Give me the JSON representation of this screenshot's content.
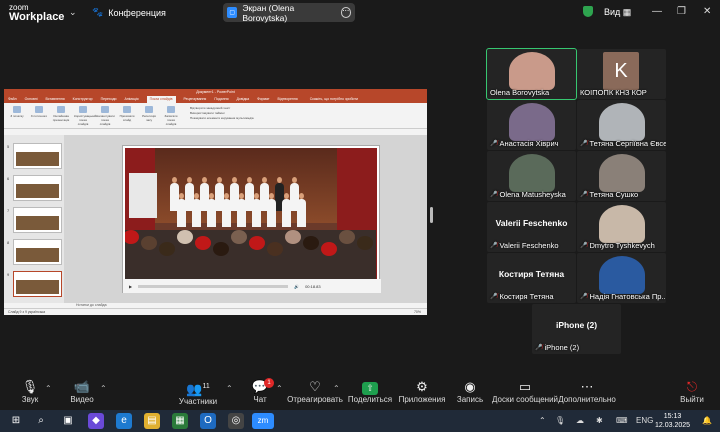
{
  "app": {
    "logo_line1": "zoom",
    "logo_line2": "Workplace"
  },
  "topbar": {
    "conference_label": "Конференция",
    "screen_share_label": "Экран (Olena Borovytska)",
    "view_label": "Вид",
    "colors": {
      "shield": "#2ea44f",
      "accent": "#2d8cff"
    }
  },
  "shared": {
    "ppt_title": "Документ1 - PowerPoint",
    "ppt_tabs": [
      "Файл",
      "Основні",
      "Вставлення",
      "Конструктор",
      "Переходи",
      "Анімація",
      "Показ слайдів",
      "Рецензування",
      "Подання",
      "Довідка",
      "Формат",
      "Відтворення"
    ],
    "ppt_active_tab": "Показ слайдів",
    "ppt_tell": "Скажіть, що потрібно зробити",
    "ribbon_items": [
      "З початку",
      "З поточного",
      "Онлайнова презентація",
      "Користувацький показ слайдів",
      "Налаштувати показ слайдів",
      "Приховати слайд",
      "Репетиція часу",
      "Записати показ слайдів"
    ],
    "ribbon_opts": [
      "Відтворити закадровий текст",
      "Використовувати таймінг",
      "Показувати елементи керування мультимедіа"
    ],
    "thumb_numbers": [
      "5",
      "6",
      "7",
      "8",
      "9"
    ],
    "video_time": "00:18.83",
    "notes_placeholder": "Нотатки до слайда",
    "status_text": "Слайд 9 з 9  українська",
    "zoom_pct": "70%"
  },
  "participants": [
    {
      "name": "Olena Borovytska",
      "muted": false,
      "active": true,
      "type": "video",
      "color": "#c99a8a"
    },
    {
      "name": "КОІПОПК КНЗ КОР",
      "muted": false,
      "active": false,
      "type": "initial",
      "initial": "K",
      "color": "#8a6a5a"
    },
    {
      "name": "Анастасія Хіврич",
      "muted": true,
      "active": false,
      "type": "video",
      "color": "#7a6a8a"
    },
    {
      "name": "Тетяна Сергіївна Євсеєва",
      "muted": true,
      "active": false,
      "type": "video",
      "color": "#b0b4b8"
    },
    {
      "name": "Olena Matusheyska",
      "muted": true,
      "active": false,
      "type": "video",
      "color": "#5a6a5a"
    },
    {
      "name": "Тетяна Сушко",
      "muted": true,
      "active": false,
      "type": "video",
      "color": "#8a8078"
    },
    {
      "name": "Valerii Feschenko",
      "bigname": "Valerii Feschenko",
      "muted": true,
      "active": false,
      "type": "name"
    },
    {
      "name": "Dmytro Tyshkevych",
      "muted": true,
      "active": false,
      "type": "video",
      "color": "#c8b8a8"
    },
    {
      "name": "Костиря Тетяна",
      "bigname": "Костиря Тетяна",
      "muted": true,
      "active": false,
      "type": "name"
    },
    {
      "name": "Надія Гнатовська Пр...",
      "muted": true,
      "active": false,
      "type": "video",
      "color": "#2a5aa0"
    },
    {
      "name": "iPhone (2)",
      "bigname": "iPhone (2)",
      "muted": true,
      "active": false,
      "type": "name"
    }
  ],
  "toolbar": {
    "audio": "Звук",
    "video": "Видео",
    "participants": "Участники",
    "participants_count": "11",
    "chat": "Чат",
    "chat_badge": "1",
    "react": "Отреагировать",
    "share": "Поделиться",
    "apps": "Приложения",
    "record": "Запись",
    "whiteboard": "Доски сообщений",
    "more": "Дополнительно",
    "leave": "Выйти"
  },
  "taskbar": {
    "lang": "ENG",
    "time": "15:13",
    "date": "12.03.2025",
    "zoom_app": "zm"
  }
}
